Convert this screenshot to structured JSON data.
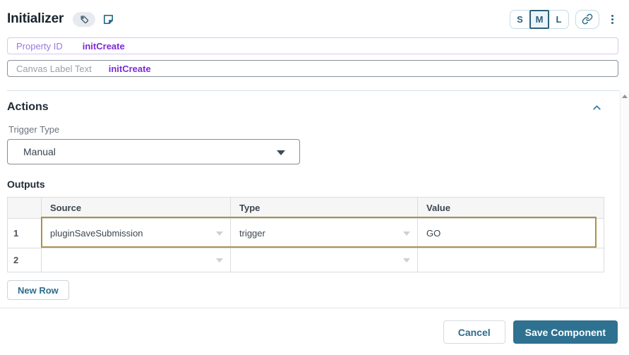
{
  "header": {
    "title": "Initializer",
    "size_small": "S",
    "size_medium": "M",
    "size_large": "L",
    "selected_size": "M"
  },
  "fields": {
    "property_id_label": "Property ID",
    "property_id_value": "initCreate",
    "canvas_label": "Canvas Label Text",
    "canvas_value": "initCreate"
  },
  "actions": {
    "section_title": "Actions",
    "trigger_type_label": "Trigger Type",
    "trigger_type_value": "Manual",
    "outputs_title": "Outputs",
    "columns": {
      "source": "Source",
      "type": "Type",
      "value": "Value"
    },
    "rows": [
      {
        "num": "1",
        "source": "pluginSaveSubmission",
        "type": "trigger",
        "value": "GO",
        "highlighted": true
      },
      {
        "num": "2",
        "source": "",
        "type": "",
        "value": "",
        "highlighted": false
      }
    ],
    "new_row_label": "New Row"
  },
  "footer": {
    "cancel_label": "Cancel",
    "save_label": "Save Component"
  },
  "icons": {
    "tag": "tag-icon",
    "note": "note-icon",
    "link": "link-icon",
    "kebab": "kebab-menu-icon",
    "collapse": "chevron-up-icon"
  },
  "colors": {
    "accent_teal": "#2d6c8a",
    "save_button_bg": "#2f7190",
    "highlight_gold": "#a8934e",
    "property_purple": "#7b2ad8",
    "title_navy": "#18252f"
  }
}
